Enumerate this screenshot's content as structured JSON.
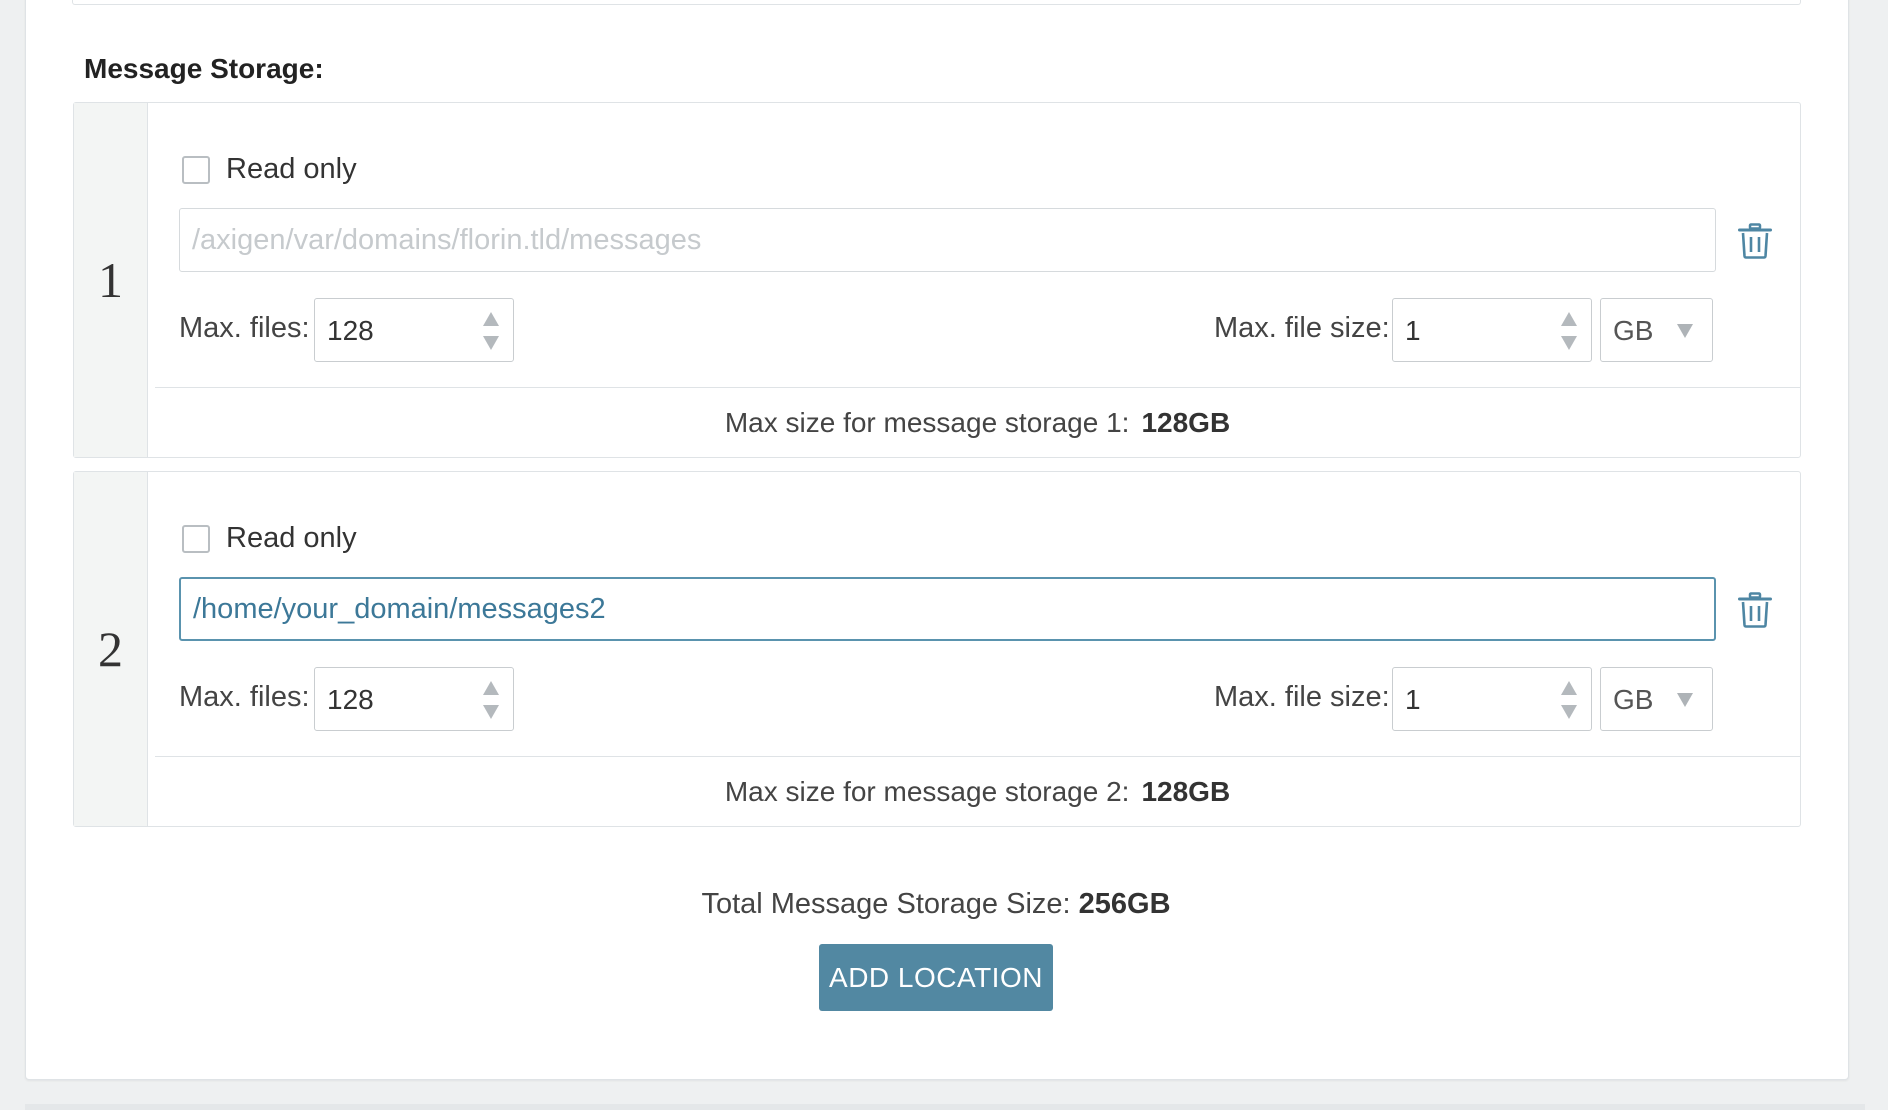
{
  "section": {
    "title": "Message Storage:"
  },
  "locations": [
    {
      "index": "1",
      "readonly_label": "Read only",
      "readonly_checked": false,
      "path_value": "",
      "path_placeholder": "/axigen/var/domains/florin.tld/messages",
      "max_files_label": "Max. files:",
      "max_files_value": "128",
      "max_file_size_label": "Max. file size:",
      "max_file_size_value": "1",
      "unit": "GB",
      "summary_label": "Max size for message storage 1:",
      "summary_value": "128GB"
    },
    {
      "index": "2",
      "readonly_label": "Read only",
      "readonly_checked": false,
      "path_value": "/home/your_domain/messages2",
      "path_placeholder": "",
      "max_files_label": "Max. files:",
      "max_files_value": "128",
      "max_file_size_label": "Max. file size:",
      "max_file_size_value": "1",
      "unit": "GB",
      "summary_label": "Max size for message storage 2:",
      "summary_value": "128GB"
    }
  ],
  "total": {
    "label": "Total Message Storage Size:",
    "value": "256GB"
  },
  "add_button": {
    "label": "ADD LOCATION"
  },
  "icons": {
    "delete": "trash-icon",
    "spinner": "spinner-arrows-icon",
    "dropdown": "caret-down-icon"
  },
  "colors": {
    "accent": "#5288a2",
    "input_text": "#3c7898",
    "placeholder": "#c6cacd",
    "focused_border": "#5a93ae",
    "index_bg": "#f3f5f4"
  }
}
